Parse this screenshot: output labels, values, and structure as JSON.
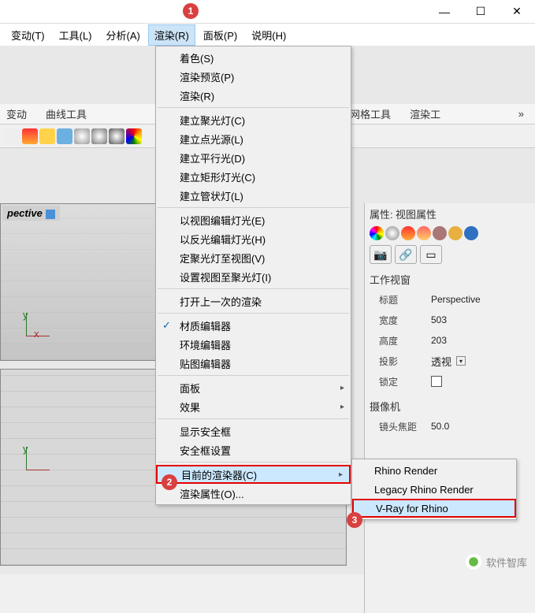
{
  "titlebar": {
    "min": "—",
    "max": "☐",
    "close": "✕"
  },
  "menubar": {
    "items": [
      "变动(T)",
      "工具(L)",
      "分析(A)",
      "渲染(R)",
      "面板(P)",
      "说明(H)"
    ],
    "active_index": 3
  },
  "tabbar": {
    "items": [
      "变动",
      "曲线工具",
      "工具",
      "网格工具",
      "渲染工"
    ],
    "more": "»"
  },
  "annotations": {
    "a1": "1",
    "a2": "2",
    "a3": "3"
  },
  "viewport": {
    "top_label": "pective",
    "axes": {
      "x": "x",
      "y": "y"
    }
  },
  "render_menu": {
    "groups": [
      [
        "着色(S)",
        "渲染预览(P)",
        "渲染(R)"
      ],
      [
        "建立聚光灯(C)",
        "建立点光源(L)",
        "建立平行光(D)",
        "建立矩形灯光(C)",
        "建立管状灯(L)"
      ],
      [
        "以视图编辑灯光(E)",
        "以反光编辑灯光(H)",
        "定聚光灯至视图(V)",
        "设置视图至聚光灯(I)"
      ],
      [
        "打开上一次的渲染"
      ],
      [
        "材质编辑器",
        "环境编辑器",
        "贴图编辑器"
      ],
      [
        "面板",
        "效果"
      ],
      [
        "显示安全框",
        "安全框设置"
      ],
      [
        "目前的渲染器(C)",
        "渲染属性(O)..."
      ]
    ],
    "checked": "材质编辑器",
    "submenu_parents": [
      "面板",
      "效果",
      "目前的渲染器(C)"
    ],
    "highlighted": "目前的渲染器(C)"
  },
  "render_submenu": {
    "items": [
      "Rhino Render",
      "Legacy Rhino Render",
      "V-Ray for Rhino"
    ],
    "highlighted": "V-Ray for Rhino"
  },
  "rpanel": {
    "header_prefix": "属性:",
    "header": "视图属性",
    "section1": "工作视窗",
    "props1": [
      {
        "label": "标题",
        "value": "Perspective"
      },
      {
        "label": "宽度",
        "value": "503"
      },
      {
        "label": "高度",
        "value": "203"
      },
      {
        "label": "投影",
        "value": "透视",
        "combo": true
      },
      {
        "label": "锁定",
        "checkbox": true
      }
    ],
    "section2": "摄像机",
    "props2": [
      {
        "label": "镜头焦距",
        "value": "50.0"
      }
    ],
    "icon_btns": {
      "cam": "📷",
      "link": "🔗",
      "rect": "▭"
    }
  },
  "icons": {
    "toolbar": [
      {
        "name": "lock-icon",
        "glyph": "🔒",
        "bg": "#eee"
      },
      {
        "name": "box-icon",
        "glyph": "◧",
        "bg": "linear-gradient(#f33,#fa3)"
      },
      {
        "name": "circle-yellow",
        "glyph": "●",
        "bg": "#ffd24a"
      },
      {
        "name": "circle-blue",
        "glyph": "●",
        "bg": "#6ab0e0"
      },
      {
        "name": "sphere1",
        "glyph": "●",
        "bg": "radial-gradient(#fff,#999)"
      },
      {
        "name": "sphere2",
        "glyph": "●",
        "bg": "radial-gradient(#fff,#777)"
      },
      {
        "name": "sphere3",
        "glyph": "●",
        "bg": "radial-gradient(#fff,#555)"
      },
      {
        "name": "sphere-rainbow",
        "glyph": "●",
        "bg": "conic-gradient(red,orange,yellow,green,blue,purple,red)"
      }
    ],
    "rpanel_row": [
      {
        "name": "palette-icon",
        "bg": "conic-gradient(red,orange,yellow,green,cyan,blue,magenta,red)"
      },
      {
        "name": "sphere-icon",
        "bg": "radial-gradient(#fff,#888)"
      },
      {
        "name": "flame-icon",
        "bg": "linear-gradient(#f33,#fa3)"
      },
      {
        "name": "flame2-icon",
        "bg": "linear-gradient(#f66,#fc6)"
      },
      {
        "name": "brush-icon",
        "bg": "#a77"
      },
      {
        "name": "folder-icon",
        "bg": "#e8b040"
      },
      {
        "name": "help-icon",
        "bg": "#3070c0"
      }
    ]
  },
  "watermark": "软件智库"
}
